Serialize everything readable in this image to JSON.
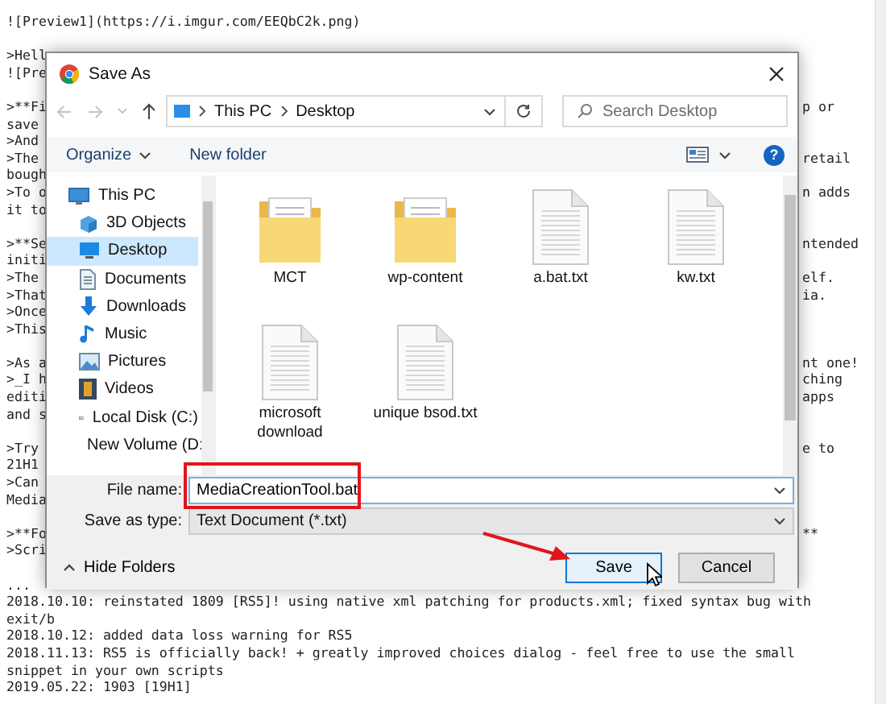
{
  "editor": {
    "paragraphs": [
      [
        {
          "left": "![Preview1](https://i.imgur.com/EEQbC2k.png)"
        }
      ],
      [
        {
          "left": ">Hell"
        },
        {
          "left": "![Pre"
        }
      ],
      [
        {
          "left": ">**Fi",
          "right": "p or"
        },
        {
          "left": "save"
        },
        {
          "left": ">And"
        },
        {
          "left": ">The",
          "right": "retail"
        },
        {
          "left": "bough"
        },
        {
          "left": ">To o",
          "right": "n adds"
        },
        {
          "left": "it to"
        }
      ],
      [
        {
          "left": ">**Se",
          "right": "ntended"
        },
        {
          "left": "initi"
        },
        {
          "left": ">The",
          "right": "elf."
        },
        {
          "left": ">That",
          "right": "ia."
        },
        {
          "left": ">Once"
        },
        {
          "left": ">This"
        }
      ],
      [
        {
          "left": ">As a",
          "right": "nt one!"
        },
        {
          "left": ">_I h",
          "right": "ching"
        },
        {
          "left": "editi",
          "right": "apps"
        },
        {
          "left": "and s"
        }
      ],
      [
        {
          "left": ">Try",
          "right": "e to"
        },
        {
          "left": "21H1"
        },
        {
          "left": ">Can"
        },
        {
          "left": "Media"
        }
      ],
      [
        {
          "left": ">**Fo",
          "right": "**"
        },
        {
          "left": ">Scri"
        }
      ],
      [
        {
          "left": "..."
        },
        {
          "left": "2018.10.10: reinstated 1809 [RS5]! using native xml patching for products.xml; fixed syntax bug with"
        },
        {
          "left": "exit/b"
        },
        {
          "left": "2018.10.12: added data loss warning for RS5"
        },
        {
          "left": "2018.11.13: RS5 is officially back! + greatly improved choices dialog - feel free to use the small"
        },
        {
          "left": "snippet in your own scripts"
        },
        {
          "left": "2019.05.22: 1903 [19H1]"
        }
      ]
    ]
  },
  "dialog": {
    "title": "Save As",
    "breadcrumb": [
      "This PC",
      "Desktop"
    ],
    "search": {
      "placeholder": "Search Desktop"
    },
    "toolbar": {
      "organize": "Organize",
      "new_folder": "New folder",
      "help": "?"
    },
    "nav": [
      {
        "label": "This PC",
        "kind": "pc",
        "selected": false
      },
      {
        "label": "3D Objects",
        "kind": "cube",
        "selected": false
      },
      {
        "label": "Desktop",
        "kind": "desktop",
        "selected": true
      },
      {
        "label": "Documents",
        "kind": "documents",
        "selected": false
      },
      {
        "label": "Downloads",
        "kind": "downloads",
        "selected": false
      },
      {
        "label": "Music",
        "kind": "music",
        "selected": false
      },
      {
        "label": "Pictures",
        "kind": "pictures",
        "selected": false
      },
      {
        "label": "Videos",
        "kind": "videos",
        "selected": false
      },
      {
        "label": "Local Disk (C:)",
        "kind": "disk",
        "selected": false
      },
      {
        "label": "New Volume (D:",
        "kind": "disk",
        "selected": false
      }
    ],
    "files": [
      {
        "name": "MCT",
        "kind": "folder"
      },
      {
        "name": "wp-content",
        "kind": "folder"
      },
      {
        "name": "a.bat.txt",
        "kind": "text"
      },
      {
        "name": "kw.txt",
        "kind": "text"
      },
      {
        "name": "microsoft download",
        "kind": "text"
      },
      {
        "name": "unique bsod.txt",
        "kind": "text"
      }
    ],
    "file_name": {
      "label": "File name:",
      "value": "MediaCreationTool.bat"
    },
    "save_as_type": {
      "label": "Save as type:",
      "value": "Text Document (*.txt)"
    },
    "hide_folders": "Hide Folders",
    "buttons": [
      {
        "label": "Save",
        "focused": true
      },
      {
        "label": "Cancel",
        "focused": false
      }
    ]
  }
}
